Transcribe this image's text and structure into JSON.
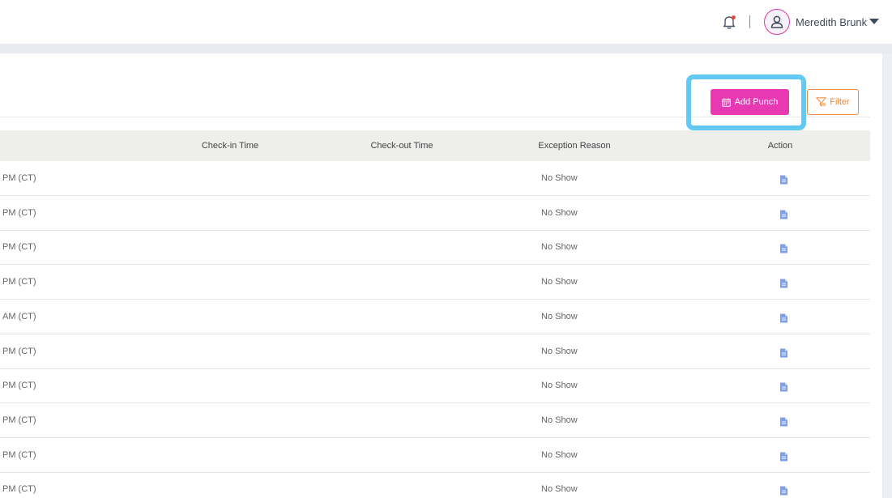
{
  "header": {
    "username": "Meredith Brunk"
  },
  "toolbar": {
    "add_punch_label": "Add Punch",
    "filter_label": "Filter"
  },
  "table": {
    "columns": [
      "Check-in Time",
      "Check-out Time",
      "Exception Reason",
      "Action"
    ],
    "rows": [
      {
        "time": "PM (CT)",
        "reason": "No Show"
      },
      {
        "time": "PM (CT)",
        "reason": "No Show"
      },
      {
        "time": "PM (CT)",
        "reason": "No Show"
      },
      {
        "time": "PM (CT)",
        "reason": "No Show"
      },
      {
        "time": "AM (CT)",
        "reason": "No Show"
      },
      {
        "time": "PM (CT)",
        "reason": "No Show"
      },
      {
        "time": "PM (CT)",
        "reason": "No Show"
      },
      {
        "time": "PM (CT)",
        "reason": "No Show"
      },
      {
        "time": "PM (CT)",
        "reason": "No Show"
      },
      {
        "time": "PM (CT)",
        "reason": "No Show"
      }
    ]
  },
  "icons": {
    "notification": "bell-icon",
    "user": "user-icon",
    "calendar": "calendar-icon",
    "filter": "filter-icon",
    "action": "document-icon"
  },
  "colors": {
    "accent_pink": "#e838b2",
    "filter_orange": "#f0883a",
    "highlight_blue": "#62c9f2",
    "action_icon_blue": "#7fa0e6",
    "notification_dot": "#e8452e"
  }
}
